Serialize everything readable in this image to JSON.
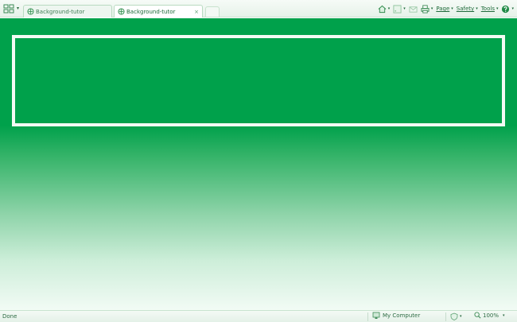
{
  "toolbar": {
    "tabs": [
      {
        "title": "Background-tutor"
      },
      {
        "title": "Background-tutor"
      }
    ],
    "tab_close_glyph": "×",
    "dropdown_glyph": "▾",
    "commands": {
      "page_label": "Page",
      "safety_label": "Safety",
      "tools_label": "Tools"
    },
    "icons": [
      "quick-tabs-icon",
      "ie-page-icon",
      "home-icon",
      "feeds-icon",
      "mail-icon",
      "print-icon",
      "help-icon"
    ]
  },
  "status_bar": {
    "status_text": "Done",
    "zone_text": "My Computer",
    "zoom_text": "100%"
  },
  "colors": {
    "content_top": "#00a14b",
    "content_bottom": "#f2fbf5",
    "box_border": "#f2fbf4"
  }
}
